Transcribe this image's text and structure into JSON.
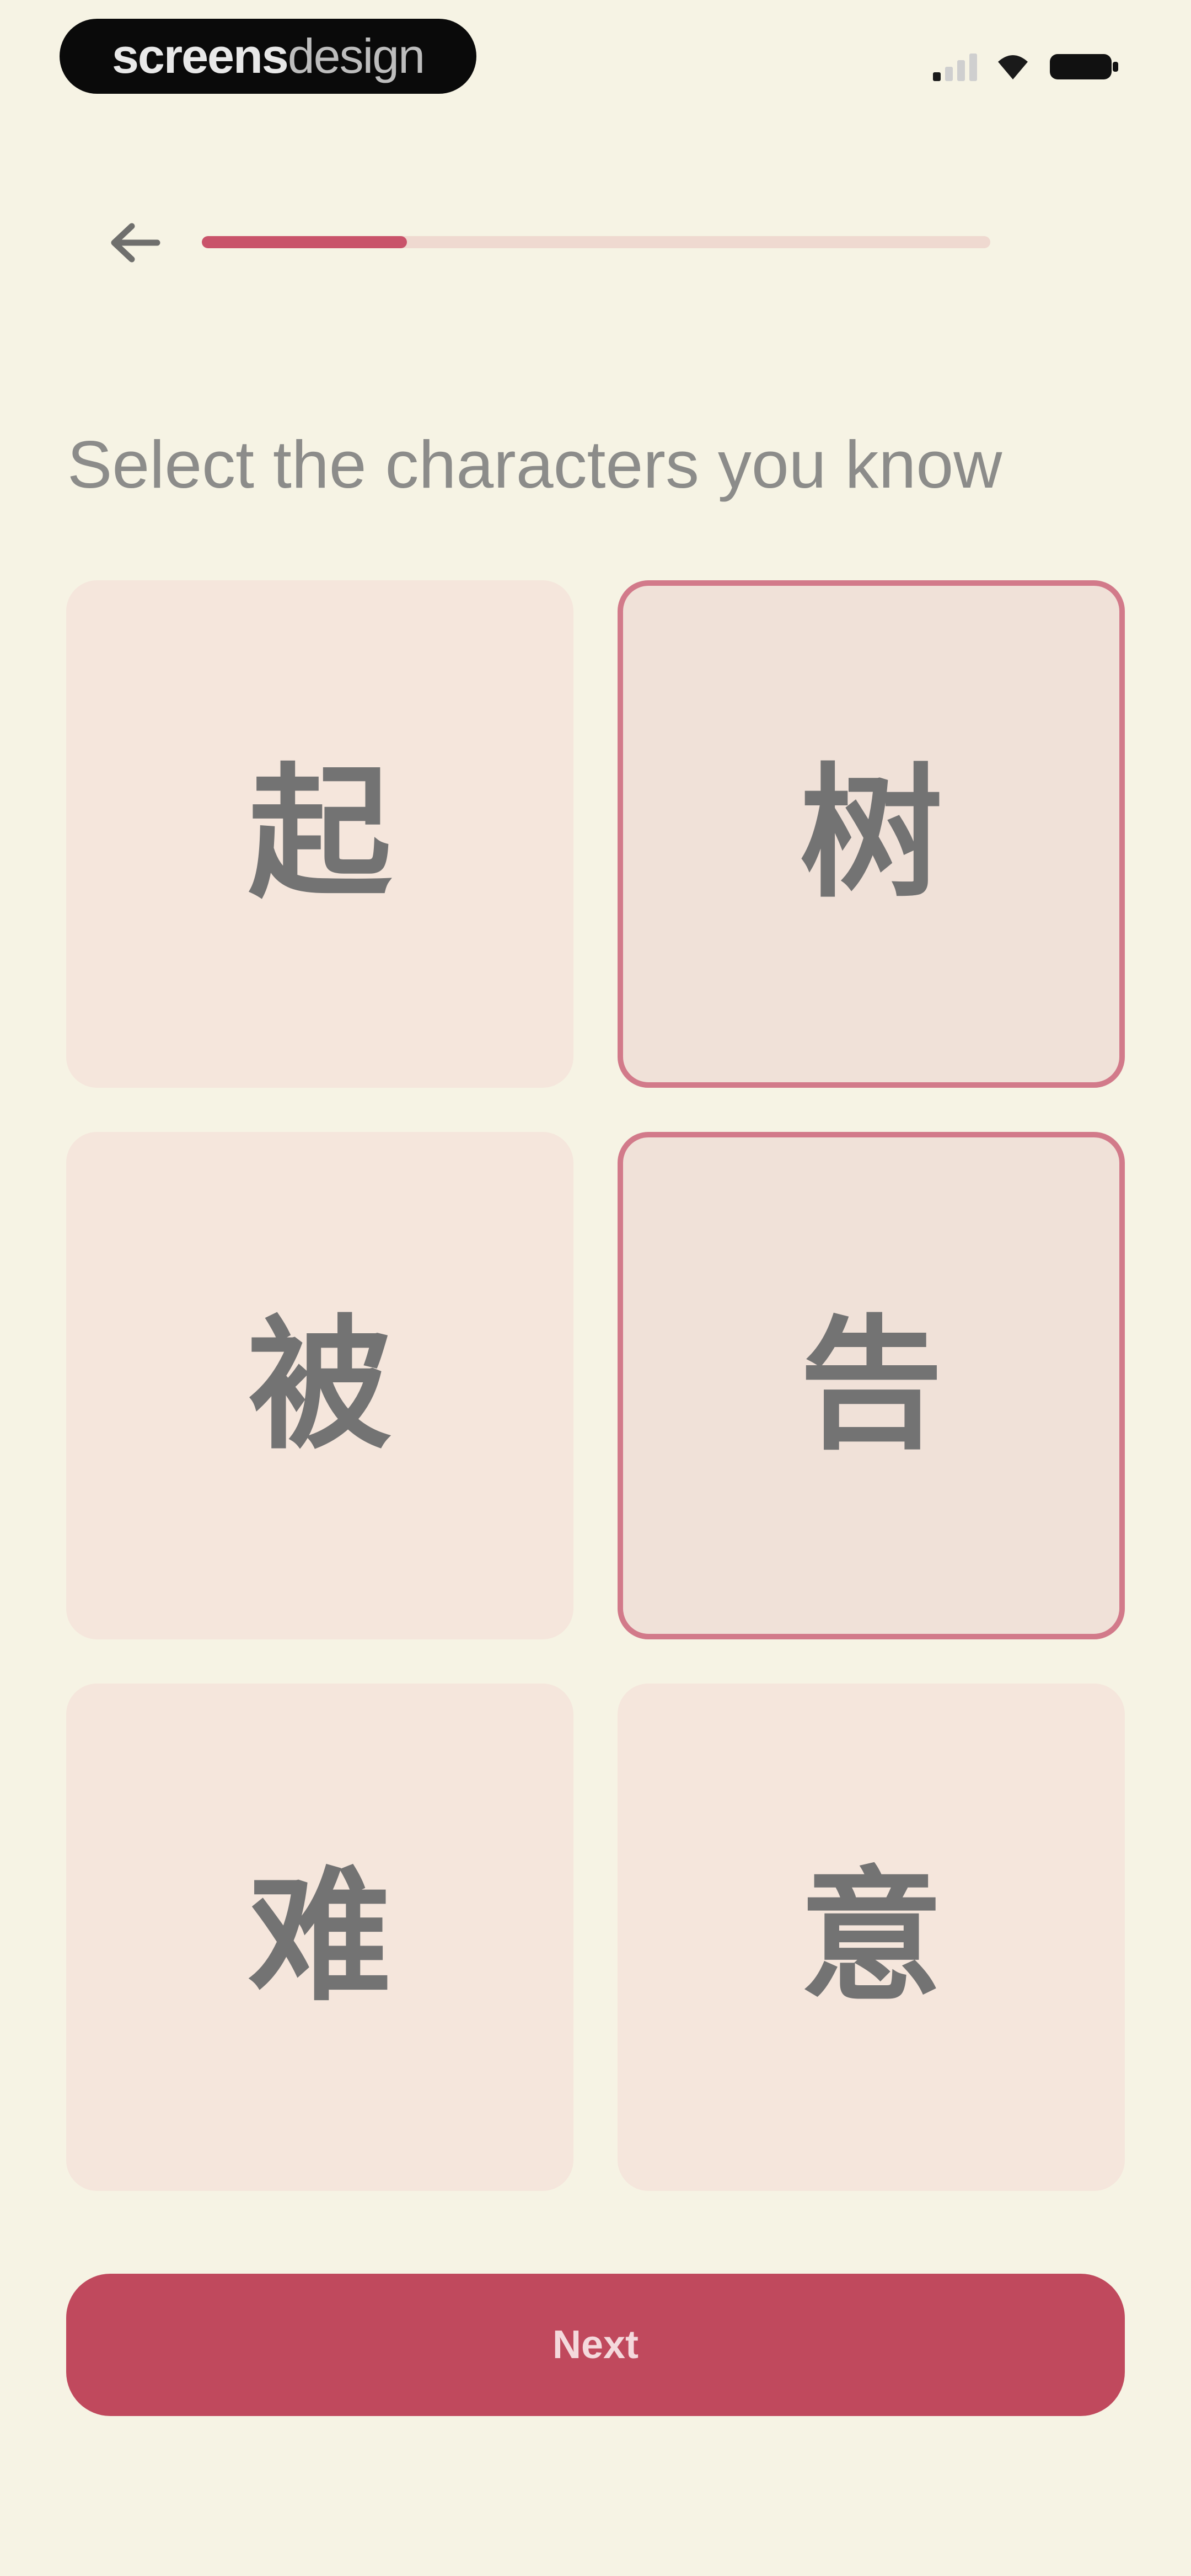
{
  "status_bar": {
    "watermark_bold": "screens",
    "watermark_light": "design"
  },
  "header": {
    "progress_fraction": 0.26
  },
  "title": "Select the characters you know",
  "characters": [
    {
      "char": "起",
      "selected": false
    },
    {
      "char": "树",
      "selected": true
    },
    {
      "char": "被",
      "selected": false
    },
    {
      "char": "告",
      "selected": true
    },
    {
      "char": "难",
      "selected": false
    },
    {
      "char": "意",
      "selected": false
    }
  ],
  "next_button": {
    "label": "Next"
  },
  "colors": {
    "background": "#f6f3e4",
    "card": "#f5e6dc",
    "card_selected_border": "#d27a8a",
    "accent": "#c0495d",
    "progress_track": "#efd9d0",
    "title_text": "#8c8c8a",
    "char_text": "#737373"
  },
  "icons": {
    "back": "arrow-left-icon",
    "signal": "cellular-signal-icon",
    "wifi": "wifi-icon",
    "battery": "battery-icon"
  }
}
